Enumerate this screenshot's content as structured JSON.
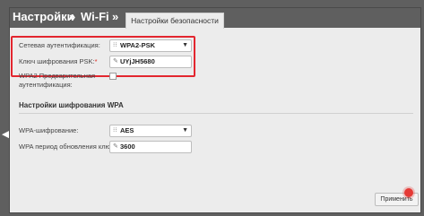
{
  "breadcrumb": {
    "items": [
      "Настройки",
      "Wi-Fi"
    ],
    "separator": "»"
  },
  "tabs": {
    "active": "Настройки безопасности"
  },
  "form": {
    "auth": {
      "label": "Сетевая аутентификация:",
      "value": "WPA2-PSK"
    },
    "psk": {
      "label": "Ключ шифрования PSK:",
      "required_mark": "*",
      "value": "UYjJH5680"
    },
    "preauth": {
      "label_line1": "WPA2 Предварительная",
      "label_line2": "аутентификация:",
      "checked": false
    },
    "section_title": "Настройки шифрования WPA",
    "wpa_encryption": {
      "label": "WPA-шифрование:",
      "value": "AES"
    },
    "rekey": {
      "label": "WPA период обновления ключа:",
      "required_mark": "*",
      "value": "3600"
    }
  },
  "actions": {
    "apply_label": "Применить"
  },
  "colors": {
    "highlight": "#e3262f",
    "panel_bg": "#ececec",
    "background": "#5f5f5f"
  }
}
